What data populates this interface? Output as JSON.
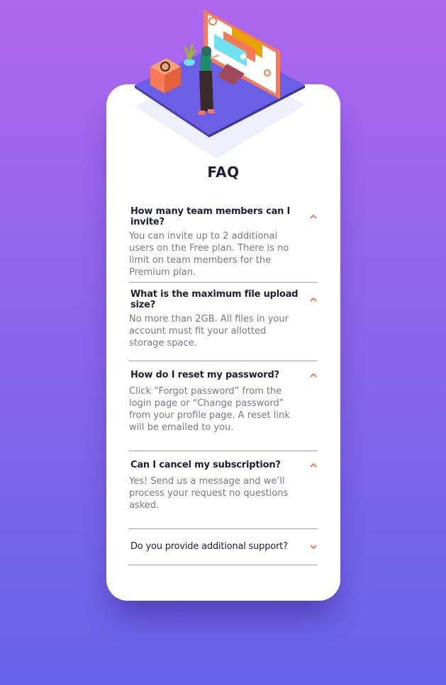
{
  "title": "FAQ",
  "faqs": [
    {
      "question": "How many team members can I invite?",
      "answer": "You can invite up to 2 additional users on the Free plan. There is no limit on team members for the Premium plan.",
      "open": true
    },
    {
      "question": "What is the maximum file upload size?",
      "answer": "No more than 2GB. All files in your account must fit your allotted storage space.",
      "open": true
    },
    {
      "question": "How do I reset my password?",
      "answer": "Click “Forgot password” from the login page or “Change password” from your profile page. A reset link will be emailed to you.",
      "open": true
    },
    {
      "question": "Can I cancel my subscription?",
      "answer": "Yes! Send us a message and we’ll process your request no questions asked.",
      "open": true
    },
    {
      "question": "Do you provide additional support?",
      "answer": "",
      "open": false
    }
  ],
  "icons": {
    "chevron_up": "chevron-up-icon",
    "chevron_down": "chevron-down-icon",
    "illustration": "woman-online-illustration"
  },
  "colors": {
    "accent": "#f47b56",
    "gradient_top": "#ae67ee",
    "gradient_bottom": "#6563e8",
    "heading": "#1e1f36",
    "body_text": "#787887",
    "divider": "#9e9fb0"
  }
}
